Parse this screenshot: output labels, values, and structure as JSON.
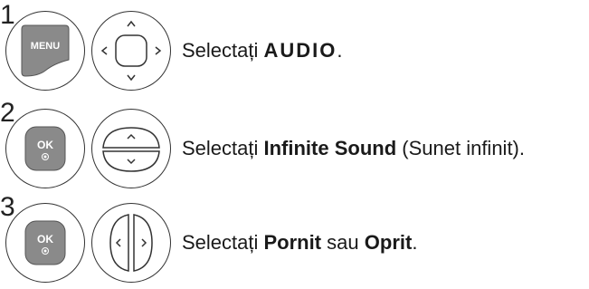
{
  "steps": [
    {
      "number": "1",
      "button": "MENU",
      "nav": "four-way-arrows-icon",
      "text_pre": "Selectați ",
      "text_bold": "AUDIO",
      "text_post": "."
    },
    {
      "number": "2",
      "button": "OK",
      "nav": "up-down-arrows-icon",
      "text_pre": "Selectați ",
      "text_bold": "Infinite Sound",
      "text_post": " (Sunet infinit)."
    },
    {
      "number": "3",
      "button": "OK",
      "nav": "left-right-arrows-icon",
      "text_pre": "Selectați ",
      "text_bold": "Pornit",
      "text_mid": " sau ",
      "text_bold2": "Oprit",
      "text_post": "."
    }
  ]
}
